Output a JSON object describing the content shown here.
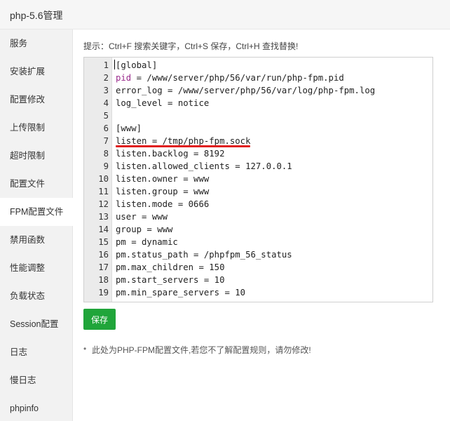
{
  "window": {
    "title": "php-5.6管理"
  },
  "sidebar": {
    "items": [
      {
        "label": "服务"
      },
      {
        "label": "安装扩展"
      },
      {
        "label": "配置修改"
      },
      {
        "label": "上传限制"
      },
      {
        "label": "超时限制"
      },
      {
        "label": "配置文件"
      },
      {
        "label": "FPM配置文件",
        "active": true
      },
      {
        "label": "禁用函数"
      },
      {
        "label": "性能调整"
      },
      {
        "label": "负载状态"
      },
      {
        "label": "Session配置"
      },
      {
        "label": "日志"
      },
      {
        "label": "慢日志"
      },
      {
        "label": "phpinfo"
      }
    ]
  },
  "hint": "提示：Ctrl+F 搜索关键字，Ctrl+S 保存，Ctrl+H 查找替换!",
  "editor": {
    "lines": [
      {
        "n": "1",
        "text": "[global]"
      },
      {
        "n": "2",
        "key": "pid",
        "rest": " = /www/server/php/56/var/run/php-fpm.pid"
      },
      {
        "n": "3",
        "text": "error_log = /www/server/php/56/var/log/php-fpm.log"
      },
      {
        "n": "4",
        "text": "log_level = notice"
      },
      {
        "n": "5",
        "text": ""
      },
      {
        "n": "6",
        "text": "[www]"
      },
      {
        "n": "7",
        "text": "listen = /tmp/php-fpm.sock"
      },
      {
        "n": "8",
        "text": "listen.backlog = 8192"
      },
      {
        "n": "9",
        "text": "listen.allowed_clients = 127.0.0.1"
      },
      {
        "n": "10",
        "text": "listen.owner = www"
      },
      {
        "n": "11",
        "text": "listen.group = www"
      },
      {
        "n": "12",
        "text": "listen.mode = 0666"
      },
      {
        "n": "13",
        "text": "user = www"
      },
      {
        "n": "14",
        "text": "group = www"
      },
      {
        "n": "15",
        "text": "pm = dynamic"
      },
      {
        "n": "16",
        "text": "pm.status_path = /phpfpm_56_status"
      },
      {
        "n": "17",
        "text": "pm.max_children = 150"
      },
      {
        "n": "18",
        "text": "pm.start_servers = 10"
      },
      {
        "n": "19",
        "text": "pm.min_spare_servers = 10"
      }
    ]
  },
  "save_button": {
    "label": "保存"
  },
  "notes": [
    "此处为PHP-FPM配置文件,若您不了解配置规则，请勿修改!"
  ],
  "colors": {
    "accent": "#20a53a",
    "highlight": "#e02020",
    "keyword": "#9a2b8c"
  }
}
